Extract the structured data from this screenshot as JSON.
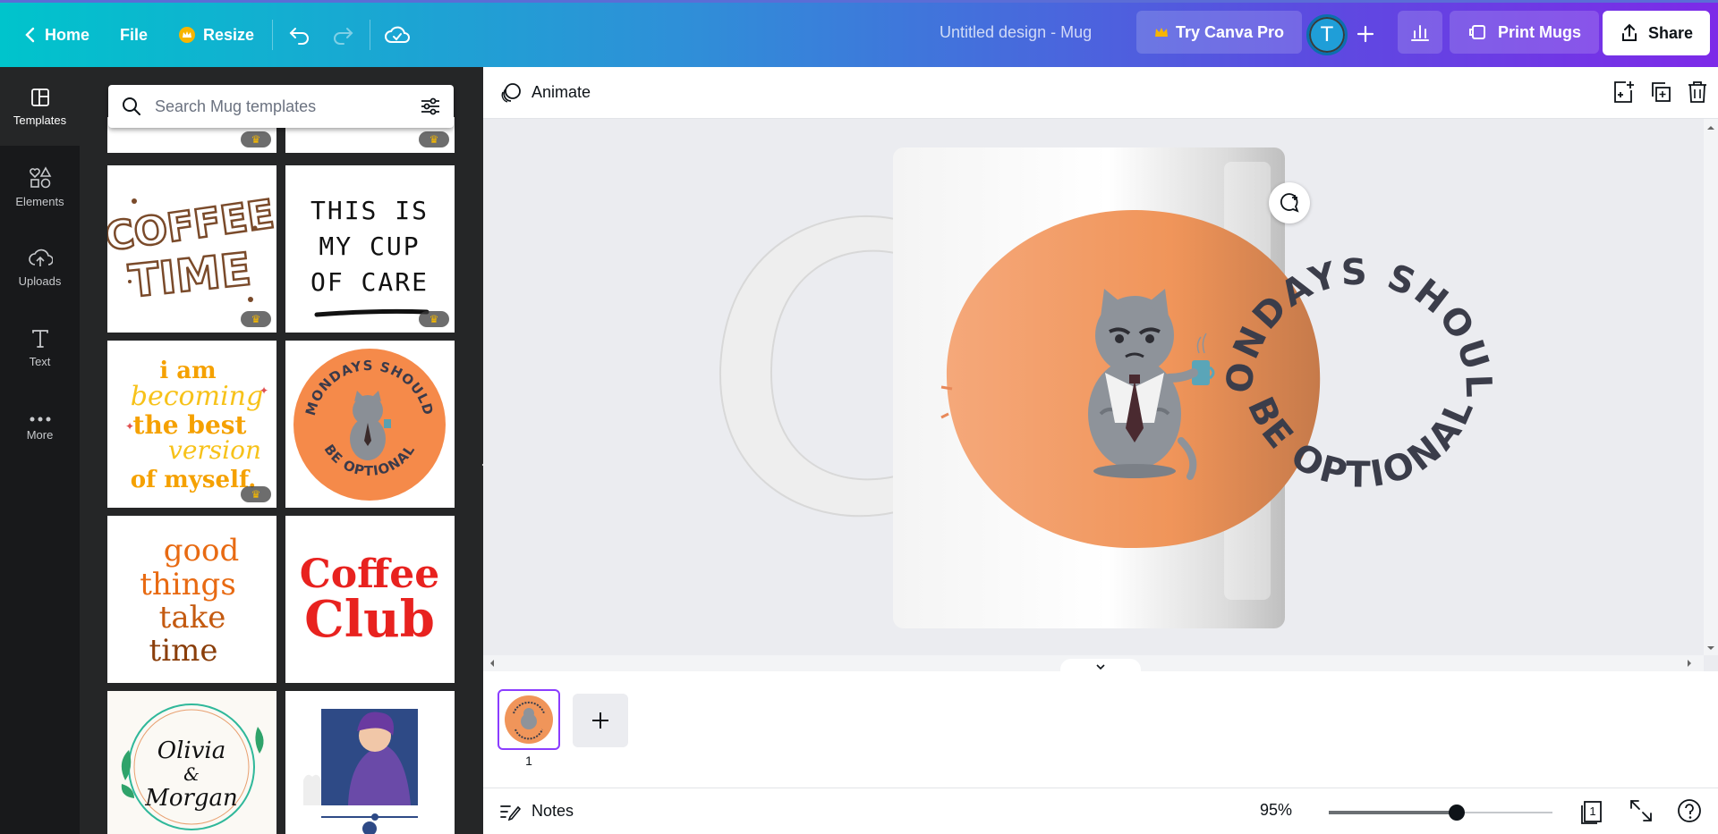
{
  "topbar": {
    "home_label": "Home",
    "file_label": "File",
    "resize_label": "Resize",
    "design_title": "Untitled design - Mug",
    "try_pro_label": "Try Canva Pro",
    "avatar_initial": "T",
    "print_label": "Print Mugs",
    "share_label": "Share"
  },
  "rail": {
    "items": [
      {
        "label": "Templates",
        "icon": "templates-icon"
      },
      {
        "label": "Elements",
        "icon": "elements-icon"
      },
      {
        "label": "Uploads",
        "icon": "uploads-icon"
      },
      {
        "label": "Text",
        "icon": "text-icon"
      },
      {
        "label": "More",
        "icon": "more-icon"
      }
    ]
  },
  "panel": {
    "search_placeholder": "Search Mug templates",
    "templates": [
      {
        "name": "coffee-time",
        "line1": "COFFEE",
        "line2": "TIME",
        "pro": true
      },
      {
        "name": "cup-of-care",
        "lines": [
          "THIS IS",
          "MY CUP",
          "OF CARE"
        ],
        "pro": true
      },
      {
        "name": "becoming-best",
        "lines": [
          "i am",
          "becoming",
          "the best",
          "version",
          "of myself."
        ],
        "pro": true
      },
      {
        "name": "mondays-optional",
        "top": "MONDAYS SHOULD",
        "bottom": "BE OPTIONAL",
        "pro": false
      },
      {
        "name": "good-things",
        "lines": [
          "good",
          "things",
          "take",
          "time"
        ],
        "pro": false
      },
      {
        "name": "coffee-club",
        "lines": [
          "Coffee",
          "Club"
        ],
        "pro": false
      },
      {
        "name": "olivia-morgan",
        "lines": [
          "Olivia",
          "&",
          "Morgan"
        ],
        "pro": false
      },
      {
        "name": "music-girl",
        "pro": false
      }
    ]
  },
  "subbar": {
    "animate_label": "Animate"
  },
  "design": {
    "top_text": "MONDAYS SHOULD",
    "bottom_text": "BE OPTIONAL",
    "circle_color": "#f0955a"
  },
  "pages": {
    "current": "1"
  },
  "footer": {
    "notes_label": "Notes",
    "zoom": "95%",
    "zoom_fraction": 0.57,
    "page_count": "1"
  }
}
